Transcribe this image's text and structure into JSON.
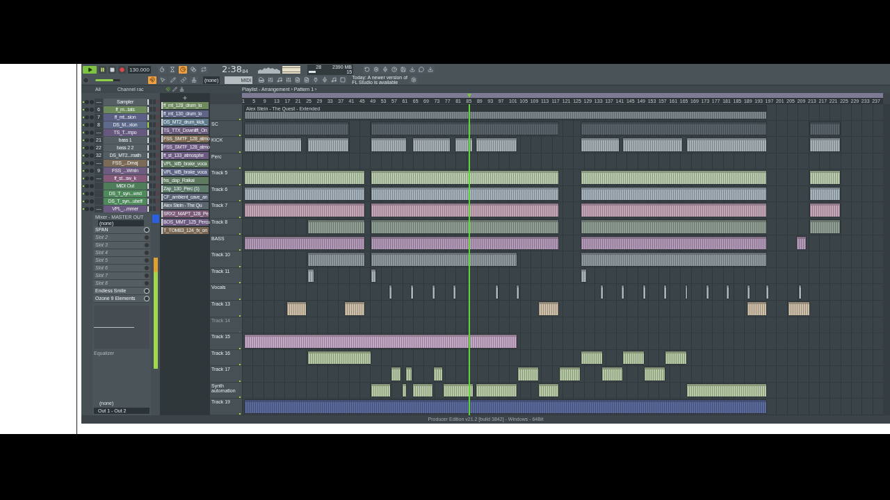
{
  "toolbar": {
    "master_volume": {
      "level": 0.72
    },
    "tempo": "130.000",
    "time": "2:38",
    "time_small": "84",
    "cpu": "28",
    "memory": "2390 MB",
    "polyphony": "15",
    "pattern_field": "(none)",
    "midi_field": "MIDI",
    "hint_lines": [
      "Today: A newer version of",
      "FL Studio is available"
    ],
    "transport": [
      {
        "kind": "song",
        "on": true
      },
      {
        "kind": "pause",
        "on": false
      },
      {
        "kind": "stop",
        "on": false
      },
      {
        "kind": "record",
        "on": false
      }
    ],
    "toggles": [
      {
        "kind": "metronome",
        "on": false
      },
      {
        "kind": "wait",
        "on": false
      },
      {
        "kind": "countdown",
        "on": true
      },
      {
        "kind": "blend",
        "on": false
      },
      {
        "kind": "loop",
        "on": false
      }
    ],
    "tools": [
      {
        "kind": "snap",
        "on": true
      },
      {
        "kind": "arrow",
        "on": false
      },
      {
        "kind": "pencil",
        "on": false
      },
      {
        "kind": "link",
        "on": false
      },
      {
        "kind": "stamp",
        "on": false
      }
    ]
  },
  "browser": {
    "filter": "All",
    "channel_rack_title": "Channel rac"
  },
  "playlist": {
    "title": "Playlist - Arrangement › Pattern 1 ›",
    "ruler": [
      "1",
      "5",
      "9",
      "13",
      "17",
      "21",
      "25",
      "29",
      "33",
      "37",
      "41",
      "45",
      "49",
      "53",
      "57",
      "61",
      "65",
      "69",
      "73",
      "77",
      "81",
      "85",
      "89",
      "93",
      "97",
      "101",
      "105",
      "109",
      "113",
      "117",
      "121",
      "125",
      "129",
      "133",
      "137",
      "141",
      "145",
      "149",
      "153",
      "157",
      "161",
      "165",
      "169",
      "173",
      "177",
      "181",
      "185",
      "189",
      "193",
      "197",
      "201",
      "205",
      "209",
      "213",
      "217",
      "221",
      "225",
      "229",
      "233",
      "237"
    ],
    "tracks": [
      {
        "clip_label": "Alex Stein - The Quest - Extended",
        "color": "#7d888d",
        "muted": false
      },
      {
        "label": "SC",
        "color": "#59636a",
        "muted": false
      },
      {
        "label": "KICK",
        "color": "#a7b0b4",
        "muted": false
      },
      {
        "label": "Perc",
        "muted": false
      },
      {
        "label": "Track 5",
        "color": "#b9ccae",
        "muted": false
      },
      {
        "label": "Track 6",
        "color": "#a6b3bd",
        "muted": false
      },
      {
        "label": "Track 7",
        "color": "#c5a7b8",
        "muted": false
      },
      {
        "label": "Track 8",
        "color": "#8f9f93",
        "muted": false
      },
      {
        "label": "BASS",
        "color": "#b39ab9",
        "muted": false
      },
      {
        "label": "Track 10",
        "color": "#8e989d",
        "muted": false
      },
      {
        "label": "Track 11",
        "color": "#a8b1b5",
        "muted": false
      },
      {
        "label": "Vocals",
        "color": "#aab3b7",
        "muted": false
      },
      {
        "label": "Track 13",
        "color": "#cdbfa8",
        "muted": false
      },
      {
        "label": "Track 14",
        "muted": true
      },
      {
        "label": "Track 15",
        "color": "#c4a8c6",
        "muted": false
      },
      {
        "label": "Track 16",
        "color": "#b5c9a4",
        "muted": false
      },
      {
        "label": "Track 17",
        "color": "#b5c9a4",
        "muted": false
      },
      {
        "label": "Synth automation",
        "color": "#b8cba6",
        "muted": false
      },
      {
        "label": "Track 19",
        "color": "#5b6a9c",
        "muted": false
      }
    ]
  },
  "channels": [
    {
      "number": "---",
      "name": "Sampler",
      "color": "#555e63",
      "selected": false
    },
    {
      "number": "6",
      "name": "ff_m...tats",
      "color": "#6d8a5a",
      "selected": false
    },
    {
      "number": "7",
      "name": "ff_mt...sion",
      "color": "#5c5f86",
      "selected": false
    },
    {
      "number": "8",
      "name": "DS_M...xion",
      "color": "#5e6a8c",
      "selected": true
    },
    {
      "number": "---",
      "name": "TS_T...mpo",
      "color": "#66587e",
      "selected": false
    },
    {
      "number": "21",
      "name": "bass 1",
      "color": "#555e63",
      "selected": false
    },
    {
      "number": "22",
      "name": "bass 2 2",
      "color": "#555e63",
      "selected": false
    },
    {
      "number": "32",
      "name": "DS_MT2...math",
      "color": "#555e63",
      "selected": false
    },
    {
      "number": "---",
      "name": "FSS_...Dmaj",
      "color": "#7b6a55",
      "selected": false
    },
    {
      "number": "9",
      "name": "FSS_...Wmin",
      "color": "#6d5a80",
      "selected": false
    },
    {
      "number": "---",
      "name": "ff_st...sw_k",
      "color": "#85597a",
      "selected": false
    },
    {
      "name": "MIDI Out",
      "color": "#4f7d5a",
      "selected": false
    },
    {
      "name": "DS_T_syn...wnd",
      "color": "#4f8a5a",
      "selected": false
    },
    {
      "name": "DS_T_syn...ubeff",
      "color": "#4f8a5a",
      "selected": false
    },
    {
      "number": "---",
      "name": "VPL_...mmer",
      "color": "#6a5a80",
      "selected": false
    }
  ],
  "picker": [
    {
      "name": "ff_mt_128_drum_lo",
      "color": "#6f8a5f"
    },
    {
      "name": "ff_mt_130_drum_lo",
      "color": "#5d6485"
    },
    {
      "name": "DS_MT2_drum_kick_",
      "color": "#5f7a8c"
    },
    {
      "name": "TS_TTX_Downlift_On",
      "color": "#6a5a7c"
    },
    {
      "name": "FSS_SMTF_128_atmo",
      "color": "#7b6852"
    },
    {
      "name": "FSS_SMTF_128_atmo",
      "color": "#6d5a80"
    },
    {
      "name": "ff_st_133_atmosphe",
      "color": "#6d5a80"
    },
    {
      "name": "VPL_kit5_brake_voca",
      "color": "#5f7a5f"
    },
    {
      "name": "VPL_kit5_brake_voca",
      "color": "#5f6685"
    },
    {
      "name": "fxs_clap_Raikai",
      "color": "#5f7a5f"
    },
    {
      "name": "Zap_130_Perc (1)",
      "color": "#5d7a6a"
    },
    {
      "name": "CF_ambient_cave_an",
      "color": "#5a6275"
    },
    {
      "name": "Alex Stein - The Qu",
      "color": "#5c6670"
    },
    {
      "name": "SRX2_MAPT_128_Pe",
      "color": "#7d5a78"
    },
    {
      "name": "BOS_MMT_125_Percu",
      "color": "#6d5a80"
    },
    {
      "name": "T_TOM83_124_fx_on",
      "color": "#7b6852"
    }
  ],
  "mixer": {
    "title": "Mixer - MASTER OUT",
    "preset": "(none)",
    "slots": [
      {
        "name": "SPAN",
        "kind": "plugin"
      },
      {
        "name": "Slot 2",
        "kind": "empty"
      },
      {
        "name": "Slot 3",
        "kind": "empty"
      },
      {
        "name": "Slot 4",
        "kind": "empty"
      },
      {
        "name": "Slot 5",
        "kind": "empty"
      },
      {
        "name": "Slot 6",
        "kind": "empty"
      },
      {
        "name": "Slot 7",
        "kind": "empty"
      },
      {
        "name": "Slot 8",
        "kind": "empty"
      },
      {
        "name": "Endless Smile",
        "kind": "plugin"
      },
      {
        "name": "Ozone 9 Elements",
        "kind": "plugin"
      }
    ],
    "eq_label": "Equalizer",
    "input": "(none)",
    "output": "Out 1 - Out 2"
  },
  "status_bar": "Producer Edition v21.2 [build 3842] - Windows - 64Bit"
}
